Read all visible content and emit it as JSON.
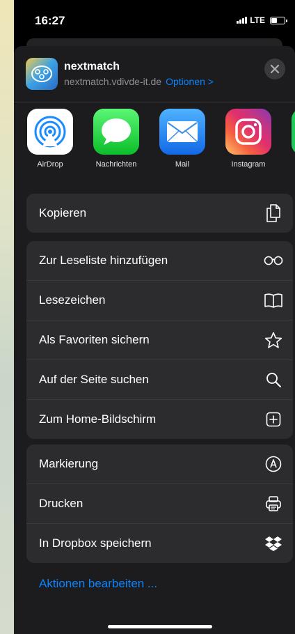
{
  "status_bar": {
    "time": "16:27",
    "network": "LTE"
  },
  "header": {
    "app_name": "nextmatch",
    "url": "nextmatch.vdivde-it.de",
    "options_label": "Optionen >",
    "icon": "nextmatch-logo-icon"
  },
  "share_targets": [
    {
      "label": "AirDrop",
      "icon": "airdrop-icon",
      "color": "#ffffff"
    },
    {
      "label": "Nachrichten",
      "icon": "messages-icon",
      "color": "#34c759"
    },
    {
      "label": "Mail",
      "icon": "mail-icon",
      "color": "#1a8cff"
    },
    {
      "label": "Instagram",
      "icon": "instagram-icon",
      "color": "#e1306c"
    }
  ],
  "groups": [
    {
      "items": [
        {
          "label": "Kopieren",
          "icon": "copy-icon"
        }
      ]
    },
    {
      "items": [
        {
          "label": "Zur Leseliste hinzufügen",
          "icon": "glasses-icon"
        },
        {
          "label": "Lesezeichen",
          "icon": "book-icon"
        },
        {
          "label": "Als Favoriten sichern",
          "icon": "star-icon"
        },
        {
          "label": "Auf der Seite suchen",
          "icon": "search-icon"
        },
        {
          "label": "Zum Home-Bildschirm",
          "icon": "add-square-icon"
        }
      ]
    },
    {
      "items": [
        {
          "label": "Markierung",
          "icon": "markup-icon"
        },
        {
          "label": "Drucken",
          "icon": "printer-icon"
        },
        {
          "label": "In Dropbox speichern",
          "icon": "dropbox-icon"
        }
      ]
    }
  ],
  "edit_actions_label": "Aktionen bearbeiten ...",
  "colors": {
    "accent": "#0a84ff",
    "sheet": "#1c1c1e",
    "cell": "#2c2c2e"
  }
}
